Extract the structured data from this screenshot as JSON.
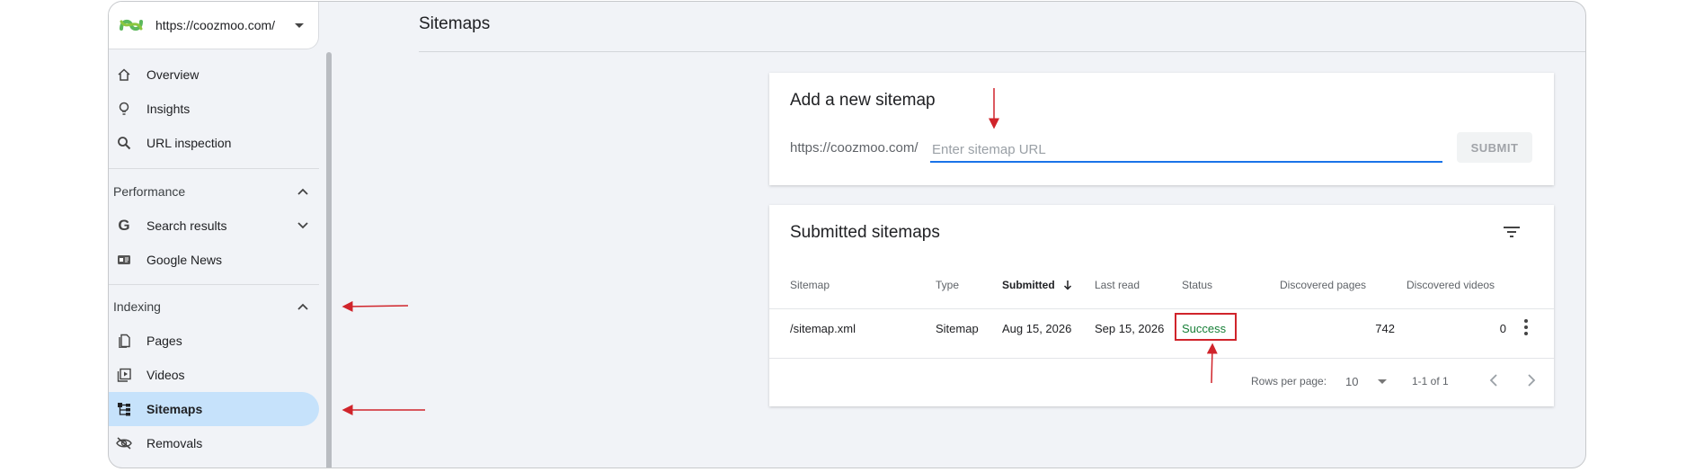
{
  "property": {
    "url": "https://coozmoo.com/"
  },
  "sidebar": {
    "items_top": [
      {
        "label": "Overview"
      },
      {
        "label": "Insights"
      },
      {
        "label": "URL inspection"
      }
    ],
    "performance": {
      "header": "Performance",
      "items": [
        {
          "label": "Search results"
        },
        {
          "label": "Google News"
        }
      ]
    },
    "indexing": {
      "header": "Indexing",
      "items": [
        {
          "label": "Pages"
        },
        {
          "label": "Videos"
        },
        {
          "label": "Sitemaps"
        },
        {
          "label": "Removals"
        }
      ]
    }
  },
  "main": {
    "title": "Sitemaps",
    "add_card": {
      "title": "Add a new sitemap",
      "prefix": "https://coozmoo.com/",
      "placeholder": "Enter sitemap URL",
      "submit": "SUBMIT"
    },
    "submitted_card": {
      "title": "Submitted sitemaps",
      "columns": [
        "Sitemap",
        "Type",
        "Submitted",
        "Last read",
        "Status",
        "Discovered pages",
        "Discovered videos"
      ],
      "rows": [
        {
          "sitemap": "/sitemap.xml",
          "type": "Sitemap",
          "submitted": "Aug 15, 2026",
          "last_read": "Sep 15, 2026",
          "status": "Success",
          "discovered_pages": "742",
          "discovered_videos": "0"
        }
      ],
      "footer": {
        "rows_per_page_label": "Rows per page:",
        "rows_per_page_value": "10",
        "range": "1-1 of 1"
      }
    }
  },
  "colors": {
    "accent": "#1a73e8",
    "active_nav": "#c6e2fb",
    "success": "#188038",
    "annotation": "#d0242b"
  }
}
